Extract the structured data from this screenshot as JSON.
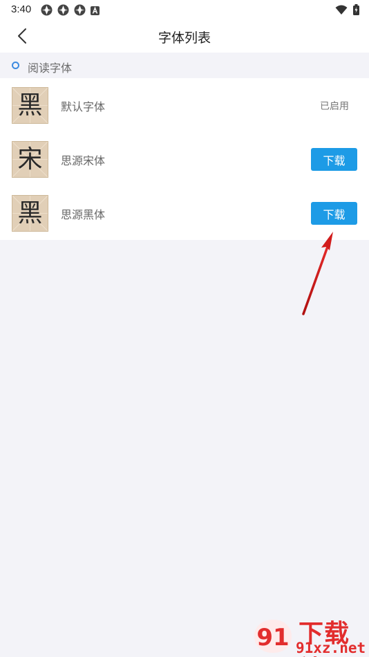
{
  "status_bar": {
    "time": "3:40"
  },
  "nav": {
    "title": "字体列表"
  },
  "section": {
    "label": "阅读字体"
  },
  "fonts": [
    {
      "thumb_char": "黑",
      "name": "默认字体",
      "status": "已启用"
    },
    {
      "thumb_char": "宋",
      "name": "思源宋体",
      "action": "下载"
    },
    {
      "thumb_char": "黑",
      "name": "思源黑体",
      "action": "下载"
    }
  ],
  "watermark": {
    "line1": "下载站",
    "line2": "91xz.net",
    "badge": "91"
  },
  "colors": {
    "accent": "#1d9be6",
    "section_dot": "#3d8be0",
    "annotation_arrow": "#d11c1c",
    "watermark": "#e22d2d"
  }
}
